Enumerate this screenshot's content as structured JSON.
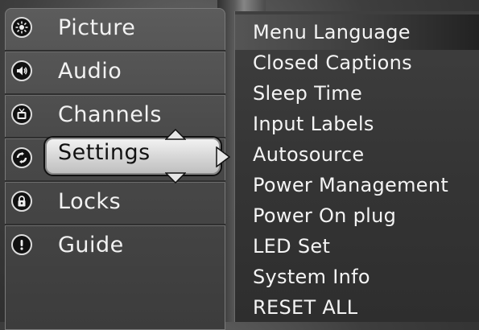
{
  "main_menu": {
    "items": [
      {
        "label": "Picture",
        "icon": "picture-icon"
      },
      {
        "label": "Audio",
        "icon": "audio-icon"
      },
      {
        "label": "Channels",
        "icon": "channels-icon"
      },
      {
        "label": "Settings",
        "icon": "settings-icon",
        "selected": true
      },
      {
        "label": "Locks",
        "icon": "lock-icon"
      },
      {
        "label": "Guide",
        "icon": "guide-icon"
      }
    ]
  },
  "settings_submenu": {
    "items": [
      {
        "label": "Menu Language",
        "highlighted": true
      },
      {
        "label": "Closed Captions"
      },
      {
        "label": "Sleep Time"
      },
      {
        "label": "Input Labels"
      },
      {
        "label": "Autosource"
      },
      {
        "label": "Power Management"
      },
      {
        "label": "Power On plug"
      },
      {
        "label": "LED Set"
      },
      {
        "label": "System Info"
      },
      {
        "label": "RESET ALL"
      }
    ]
  },
  "colors": {
    "text": "#f2f2f2",
    "selected_pill": "#d2d2d2",
    "panel": "#4a4a4a"
  }
}
